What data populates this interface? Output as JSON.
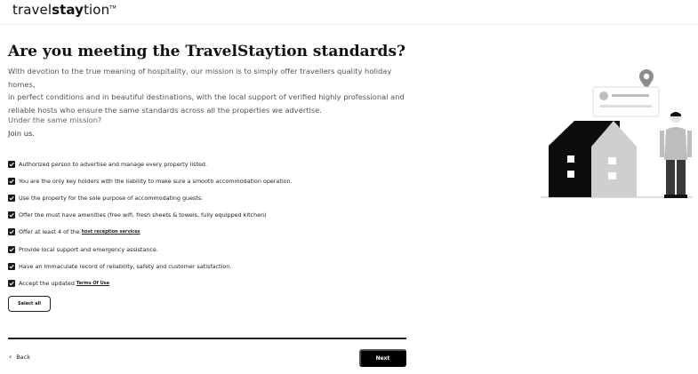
{
  "logo": {
    "light": "travel",
    "bold": "stay",
    "light2": "tion",
    "tm": "TM"
  },
  "title": "Are you meeting the TravelStaytion standards?",
  "intro": [
    "With devotion to the true meaning of hospitality, our mission is to simply offer travellers quality holiday homes,",
    "in perfect conditions and in beautiful destinations, with the local support of verified highly professional and",
    "reliable hosts who ensure the same standards across all the properties we advertise."
  ],
  "mission": {
    "line1": "Under the same mission?",
    "line2": "Join us."
  },
  "checklist": [
    {
      "text": "Authorized person to advertise and manage every property listed.",
      "link": "",
      "checked": true
    },
    {
      "text": "You are the only key holders with the liability to make sure a smooth accommodation operation.",
      "link": "",
      "checked": true
    },
    {
      "text": "Use the property for the sole purpose of accommodating guests.",
      "link": "",
      "checked": true
    },
    {
      "text": "Offer the must have amenities (free wifi, fresh sheets & towels, fully equipped kitchen)",
      "link": "",
      "checked": true
    },
    {
      "text": "Offer at least 4 of the",
      "link": "host reception services",
      "checked": true
    },
    {
      "text": "Provide local support and emergency assistance.",
      "link": "",
      "checked": true
    },
    {
      "text": "Have an immaculate record of reliability, safety and customer satisfaction.",
      "link": "",
      "checked": true
    },
    {
      "text": "Accept the updated",
      "link": "Terms Of Use",
      "checked": true
    }
  ],
  "buttons": {
    "select_all": "Select all",
    "back": "Back",
    "next": "Next"
  },
  "icons": {
    "back": "chevron-left-icon",
    "check": "checkmark-icon",
    "location": "location-pin-icon"
  },
  "colors": {
    "text": "#222222",
    "muted": "#555555",
    "button_bg": "#000000",
    "button_text": "#ffffff",
    "house_dark": "#0d0d0d",
    "house_light": "#cfcfcf"
  }
}
